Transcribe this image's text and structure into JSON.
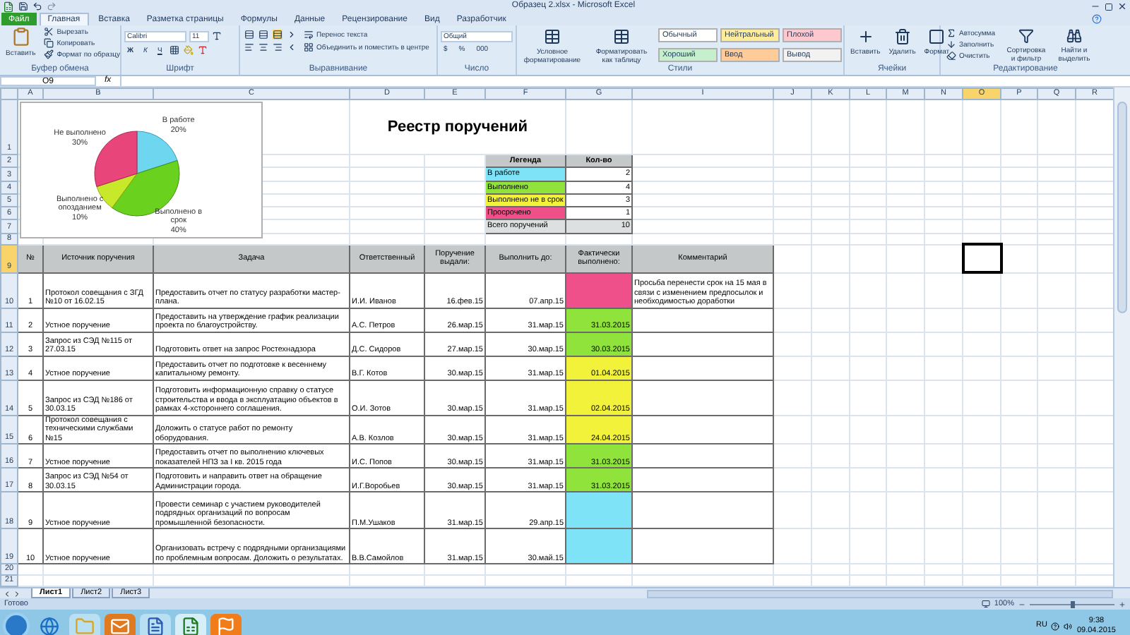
{
  "window": {
    "title": "Образец 2.xlsx - Microsoft Excel"
  },
  "tabs": [
    {
      "label": "Файл",
      "kind": "file",
      "selected": false
    },
    {
      "label": "Главная",
      "kind": "tab",
      "selected": true
    },
    {
      "label": "Вставка",
      "kind": "tab",
      "selected": false
    },
    {
      "label": "Разметка страницы",
      "kind": "tab",
      "selected": false
    },
    {
      "label": "Формулы",
      "kind": "tab",
      "selected": false
    },
    {
      "label": "Данные",
      "kind": "tab",
      "selected": false
    },
    {
      "label": "Рецензирование",
      "kind": "tab",
      "selected": false
    },
    {
      "label": "Вид",
      "kind": "tab",
      "selected": false
    },
    {
      "label": "Разработчик",
      "kind": "tab",
      "selected": false
    }
  ],
  "ribbon": {
    "clipboard": {
      "label": "Буфер обмена",
      "paste": "Вставить",
      "cut": "Вырезать",
      "copy": "Копировать",
      "format_painter": "Формат по образцу"
    },
    "font": {
      "label": "Шрифт",
      "name": "Calibri",
      "size": "11",
      "bold": "Ж",
      "italic": "К",
      "underline": "Ч"
    },
    "alignment": {
      "label": "Выравнивание",
      "wrap": "Перенос текста",
      "merge": "Объединить и поместить в центре"
    },
    "number": {
      "label": "Число",
      "format": "Общий",
      "currency": "$",
      "percent": "%",
      "thousands": "000"
    },
    "styles": {
      "label": "Стили",
      "conditional": "Условное форматирование",
      "as_table": "Форматировать как таблицу",
      "cell_styles": [
        {
          "label": "Обычный",
          "color": "#ffffff"
        },
        {
          "label": "Нейтральный",
          "color": "#ffeb9c"
        },
        {
          "label": "Плохой",
          "color": "#ffc7ce"
        },
        {
          "label": "Хороший",
          "color": "#c6efce"
        },
        {
          "label": "Ввод",
          "color": "#ffcc99"
        },
        {
          "label": "Вывод",
          "color": "#f2f2f2"
        }
      ]
    },
    "cells": {
      "label": "Ячейки",
      "insert": "Вставить",
      "delete": "Удалить",
      "format": "Формат"
    },
    "editing": {
      "label": "Редактирование",
      "autosum": "Автосумма",
      "fill": "Заполнить",
      "clear": "Очистить",
      "sort": "Сортировка и фильтр",
      "find": "Найти и выделить"
    }
  },
  "formula_bar": {
    "name_box": "O9",
    "function_label": "fx"
  },
  "columns": [
    {
      "label": "A",
      "selected": false
    },
    {
      "label": "B",
      "selected": false
    },
    {
      "label": "C",
      "selected": false
    },
    {
      "label": "D",
      "selected": false
    },
    {
      "label": "E",
      "selected": false
    },
    {
      "label": "F",
      "selected": false
    },
    {
      "label": "G",
      "selected": false
    },
    {
      "label": "I",
      "selected": false
    },
    {
      "label": "J",
      "selected": false
    },
    {
      "label": "K",
      "selected": false
    },
    {
      "label": "L",
      "selected": false
    },
    {
      "label": "M",
      "selected": false
    },
    {
      "label": "N",
      "selected": false
    },
    {
      "label": "O",
      "selected": true
    },
    {
      "label": "P",
      "selected": false
    },
    {
      "label": "Q",
      "selected": false
    },
    {
      "label": "R",
      "selected": false
    }
  ],
  "rows": [
    {
      "label": "1",
      "selected": false
    },
    {
      "label": "2",
      "selected": false
    },
    {
      "label": "3",
      "selected": false
    },
    {
      "label": "4",
      "selected": false
    },
    {
      "label": "5",
      "selected": false
    },
    {
      "label": "6",
      "selected": false
    },
    {
      "label": "7",
      "selected": false
    },
    {
      "label": "8",
      "selected": false
    },
    {
      "label": "9",
      "selected": true
    },
    {
      "label": "10",
      "selected": false
    },
    {
      "label": "11",
      "selected": false
    },
    {
      "label": "12",
      "selected": false
    },
    {
      "label": "13",
      "selected": false
    },
    {
      "label": "14",
      "selected": false
    },
    {
      "label": "15",
      "selected": false
    },
    {
      "label": "16",
      "selected": false
    },
    {
      "label": "17",
      "selected": false
    },
    {
      "label": "18",
      "selected": false
    },
    {
      "label": "19",
      "selected": false
    },
    {
      "label": "20",
      "selected": false
    },
    {
      "label": "21",
      "selected": false
    }
  ],
  "chart": {
    "chart_data": {
      "type": "pie",
      "categories": [
        "В работе",
        "Выполнено в срок",
        "Выполнено с опозданием",
        "Не выполнено"
      ],
      "values": [
        20,
        40,
        10,
        30
      ],
      "data_labels": true,
      "value_labels": [
        "20%",
        "40%",
        "10%",
        "30%"
      ]
    }
  },
  "heading": "Реестр поручений",
  "legend": {
    "columns": [
      "Легенда",
      "Кол-во"
    ],
    "items": [
      {
        "label": "В работе",
        "count": "2",
        "color": "#7fe3f7"
      },
      {
        "label": "Выполнено",
        "count": "4",
        "color": "#8fe33a"
      },
      {
        "label": "Выполнено не в срок",
        "count": "3",
        "color": "#f2f23a"
      },
      {
        "label": "Просрочено",
        "count": "1",
        "color": "#f0508a"
      }
    ],
    "total": {
      "label": "Всего поручений",
      "count": "10"
    }
  },
  "table": {
    "columns": [
      "№",
      "Источник поручения",
      "Задача",
      "Ответственный",
      "Поручение выдали:",
      "Выполнить до:",
      "Фактически выполнено:",
      "Комментарий"
    ],
    "rows": [
      {
        "n": "1",
        "source": "Протокол совещания с ЗГД №10 от 16.02.15",
        "task": "Предоставить отчет по статусу разработки мастер-плана.",
        "person": "И.И. Иванов",
        "issued": "16.фев.15",
        "due": "07.апр.15",
        "done": "",
        "color": "#f0508a",
        "comment": "Просьба перенести срок на 15 мая в связи с изменением предпосылок и необходимостью доработки"
      },
      {
        "n": "2",
        "source": "Устное поручение",
        "task": "Предоставить на утверждение график реализации проекта по благоустройству.",
        "person": "А.С. Петров",
        "issued": "26.мар.15",
        "due": "31.мар.15",
        "done": "31.03.2015",
        "color": "#8fe33a",
        "comment": ""
      },
      {
        "n": "3",
        "source": "Запрос из СЭД №115 от 27.03.15",
        "task": "Подготовить ответ на запрос Ростехнадзора",
        "person": "Д.С. Сидоров",
        "issued": "27.мар.15",
        "due": "30.мар.15",
        "done": "30.03.2015",
        "color": "#8fe33a",
        "comment": ""
      },
      {
        "n": "4",
        "source": "Устное поручение",
        "task": "Предоставить отчет по подготовке к весеннему капитальному ремонту.",
        "person": "В.Г. Котов",
        "issued": "30.мар.15",
        "due": "31.мар.15",
        "done": "01.04.2015",
        "color": "#f2f23a",
        "comment": ""
      },
      {
        "n": "5",
        "source": "Запрос из СЭД №186 от 30.03.15",
        "task": "Подготовить информационную справку о статусе строительства и ввода в эксплуатацию объектов в рамках 4-хстороннего соглашения.",
        "person": "О.И. Зотов",
        "issued": "30.мар.15",
        "due": "31.мар.15",
        "done": "02.04.2015",
        "color": "#f2f23a",
        "comment": ""
      },
      {
        "n": "6",
        "source": "Протокол совещания с техническими службами №15",
        "task": "Доложить о статусе работ по ремонту оборудования.",
        "person": "А.В. Козлов",
        "issued": "30.мар.15",
        "due": "31.мар.15",
        "done": "24.04.2015",
        "color": "#f2f23a",
        "comment": ""
      },
      {
        "n": "7",
        "source": "Устное поручение",
        "task": "Предоставить отчет по выполнению ключевых показателей НПЗ за I кв. 2015 года",
        "person": "И.С. Попов",
        "issued": "30.мар.15",
        "due": "31.мар.15",
        "done": "31.03.2015",
        "color": "#8fe33a",
        "comment": ""
      },
      {
        "n": "8",
        "source": "Запрос из СЭД №54 от 30.03.15",
        "task": "Подготовить и направить ответ на обращение Администрации города.",
        "person": "И.Г.Воробьев",
        "issued": "30.мар.15",
        "due": "31.мар.15",
        "done": "31.03.2015",
        "color": "#8fe33a",
        "comment": ""
      },
      {
        "n": "9",
        "source": "Устное поручение",
        "task": "Провести семинар с участием руководителей подрядных организаций по вопросам промышленной безопасности.",
        "person": "П.М.Ушаков",
        "issued": "31.мар.15",
        "due": "29.апр.15",
        "done": "",
        "color": "#7fe3f7",
        "comment": ""
      },
      {
        "n": "10",
        "source": "Устное поручение",
        "task": "Организовать встречу с подрядными организациями по проблемным вопросам. Доложить о результатах.",
        "person": "В.В.Самойлов",
        "issued": "31.мар.15",
        "due": "30.май.15",
        "done": "",
        "color": "#7fe3f7",
        "comment": ""
      }
    ]
  },
  "sheet_tabs": [
    {
      "label": "Лист1",
      "selected": true
    },
    {
      "label": "Лист2",
      "selected": false
    },
    {
      "label": "Лист3",
      "selected": false
    }
  ],
  "status_bar": {
    "status": "Готово",
    "zoom": "100%",
    "zoom_slider": {
      "level": 0.5
    }
  },
  "taskbar": {
    "language": "RU",
    "time": "9:38",
    "date": "09.04.2015"
  }
}
